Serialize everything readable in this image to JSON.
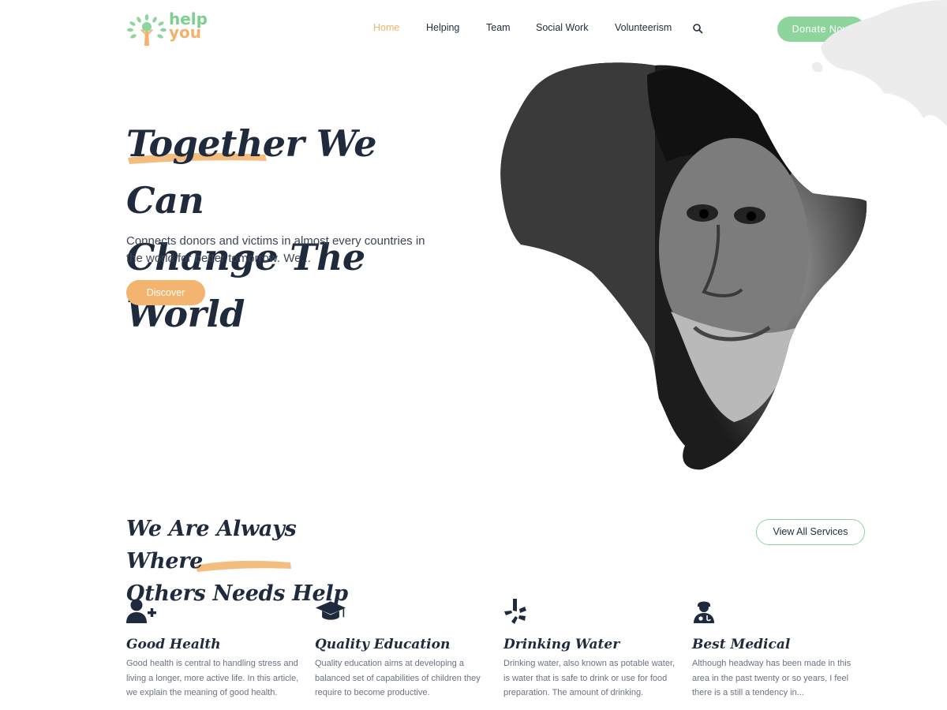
{
  "brand": {
    "name_part1": "help",
    "name_part2": "you"
  },
  "nav": {
    "items": [
      {
        "label": "Home",
        "active": true
      },
      {
        "label": "Helping",
        "active": false
      },
      {
        "label": "Team",
        "active": false
      },
      {
        "label": "Social Work",
        "active": false
      },
      {
        "label": "Volunteerism",
        "active": false
      }
    ],
    "search_icon": "search-icon",
    "donate_label": "Donate Now"
  },
  "hero": {
    "title_line1_highlight": "Together",
    "title_line1_rest": " We Can",
    "title_line2": "Change The World",
    "description": "Connects donors and victims in almost every countries in the world for better tomorrow. We...",
    "discover_label": "Discover",
    "image_icon": "africa-shaped-portrait-image"
  },
  "services_section": {
    "title_line1": "We Are Always Where",
    "title_line2_a": "Others ",
    "title_line2_highlight": "Needs Help",
    "view_all_label": "View All Services",
    "items": [
      {
        "icon": "user-plus-icon",
        "title": "Good Health",
        "description": "Good health is central to handling stress and living a longer, more active life. In this article, we explain the meaning of good health."
      },
      {
        "icon": "graduation-cap-icon",
        "title": "Quality Education",
        "description": "Quality education aims at developing a balanced set of capabilities of children they require to become productive."
      },
      {
        "icon": "yelp-icon",
        "title": "Drinking Water",
        "description": "Drinking water, also known as potable water, is water that is safe to drink or use for food preparation. The amount of drinking."
      },
      {
        "icon": "user-doctor-icon",
        "title": "Best Medical",
        "description": "Although headway has been made in this area in the past twenty or so years, I feel there is a still a tendency in..."
      }
    ]
  },
  "colors": {
    "accent_orange": "#f2b26a",
    "accent_green": "#8ed59d",
    "text_dark": "#1f2b3d"
  }
}
